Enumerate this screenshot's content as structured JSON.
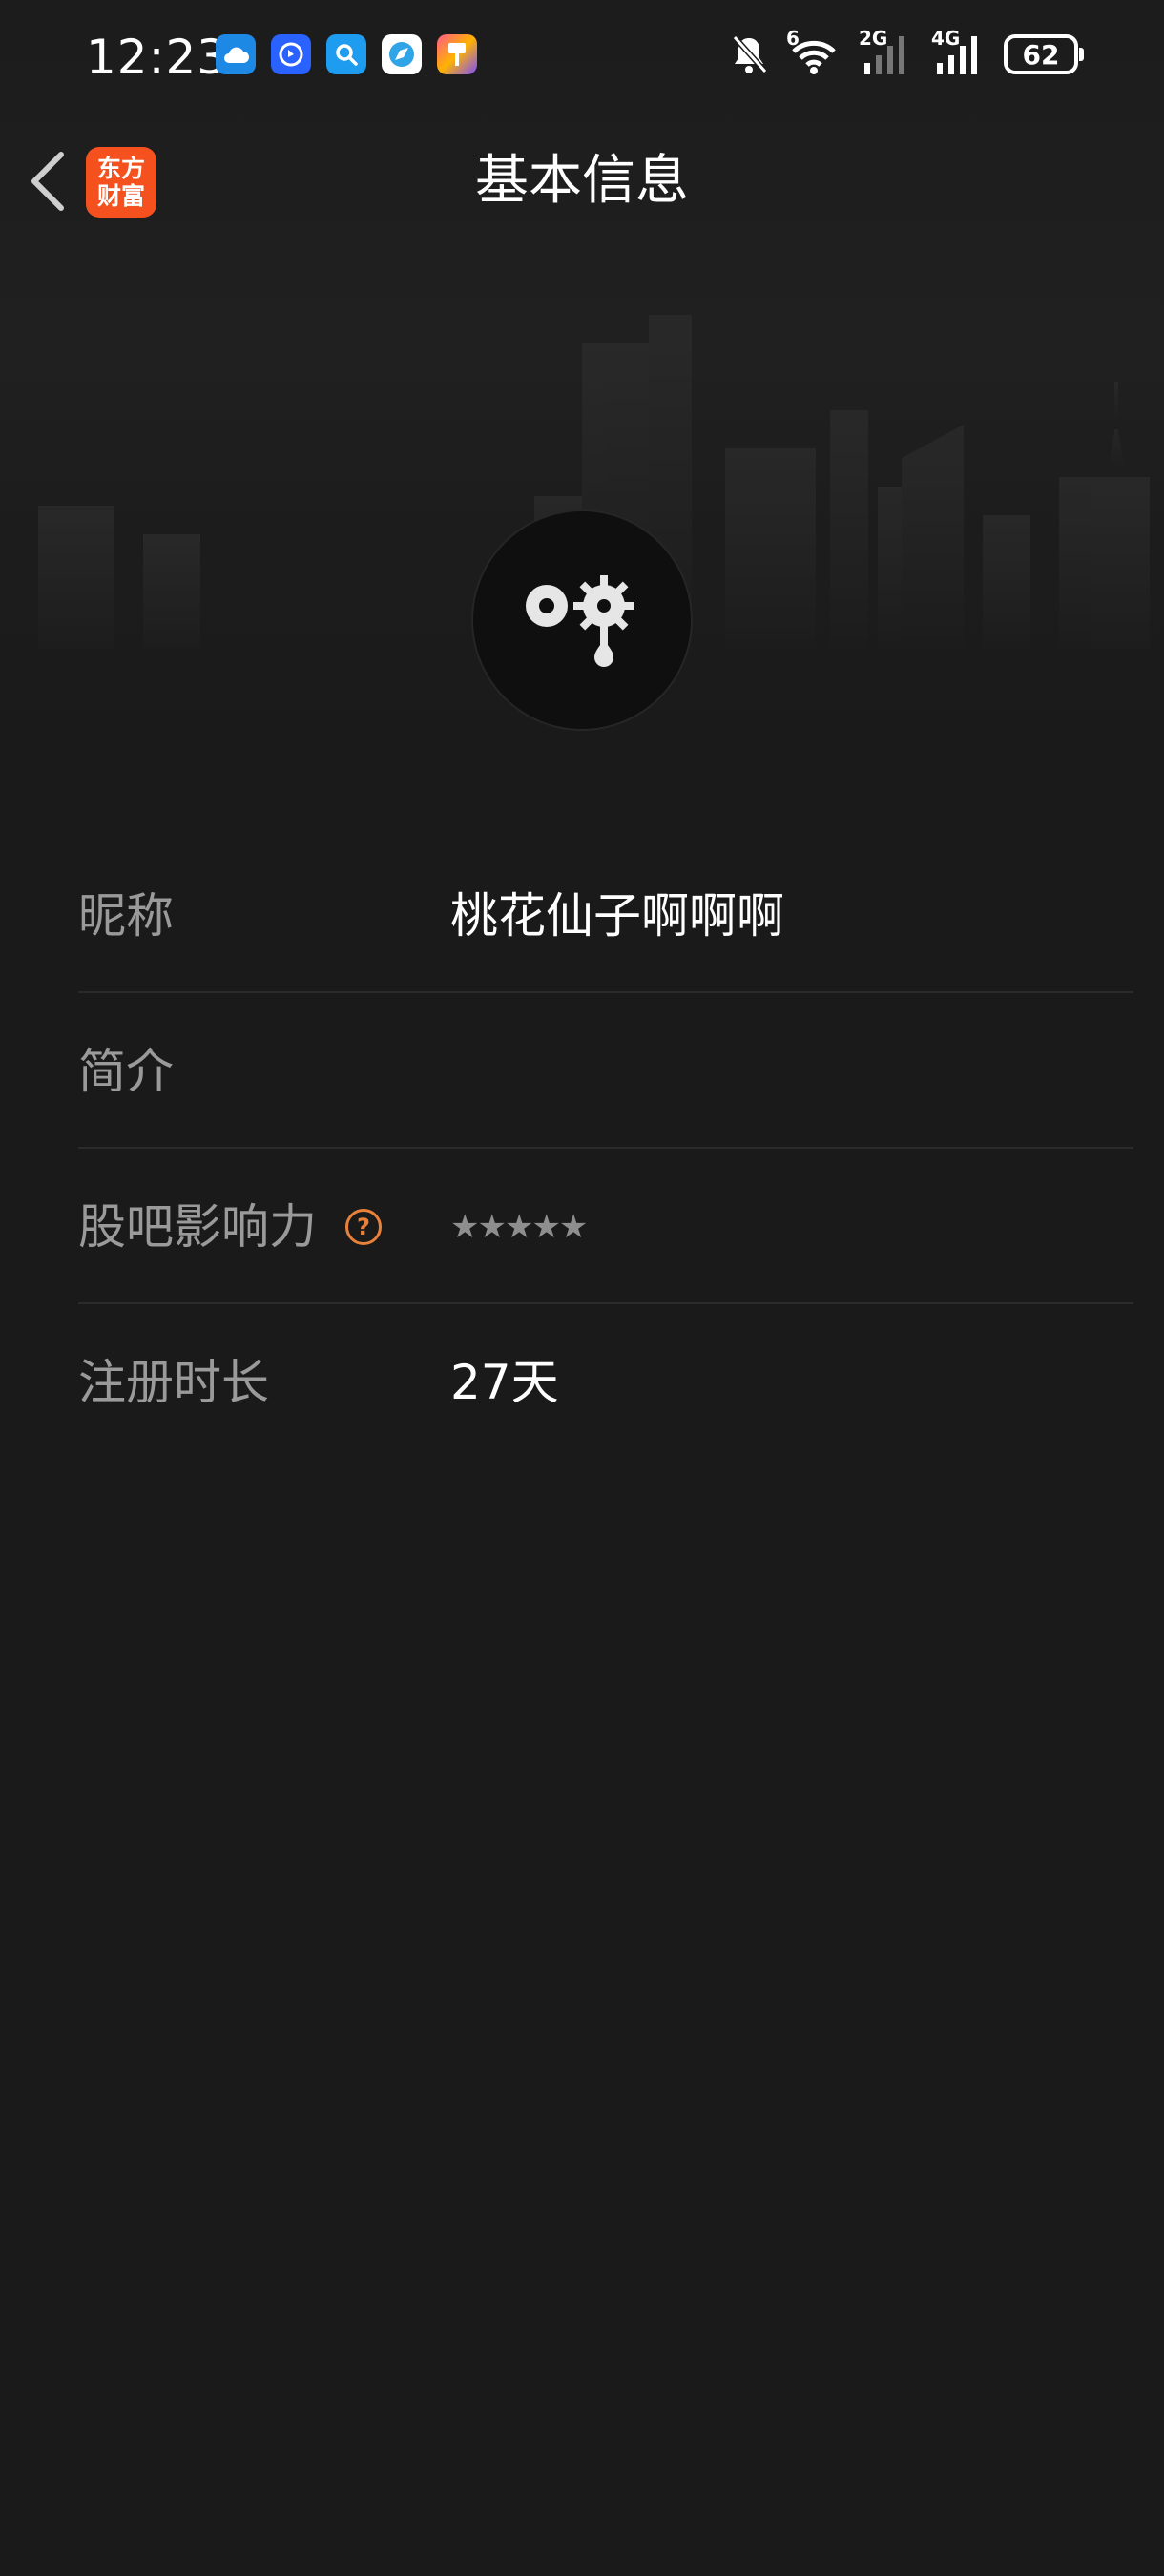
{
  "status_bar": {
    "time": "12:23",
    "notification_icons": [
      "cloud-icon",
      "hand-app-icon",
      "search-app-icon",
      "browser-icon",
      "paint-app-icon"
    ],
    "wifi_label": "6",
    "signal1_label": "2G",
    "signal2_label": "4G",
    "battery": "62"
  },
  "nav": {
    "app_logo_line1": "东方",
    "app_logo_line2": "财富",
    "title": "基本信息"
  },
  "profile": {
    "avatar_icon": "gear-drop-icon"
  },
  "info": {
    "rows": [
      {
        "label": "昵称",
        "value": "桃花仙子啊啊啊"
      },
      {
        "label": "简介",
        "value": ""
      },
      {
        "label": "股吧影响力",
        "rating_max": 5,
        "rating": 0
      },
      {
        "label": "注册时长",
        "value": "27天"
      }
    ],
    "help_symbol": "?",
    "stars_text": "★★★★★"
  },
  "colors": {
    "background": "#1a1a1a",
    "brand": "#f4511e",
    "accent_help": "#e8823a",
    "label": "#9a9a9a",
    "value": "#ffffff",
    "divider": "#2b2b2b"
  }
}
